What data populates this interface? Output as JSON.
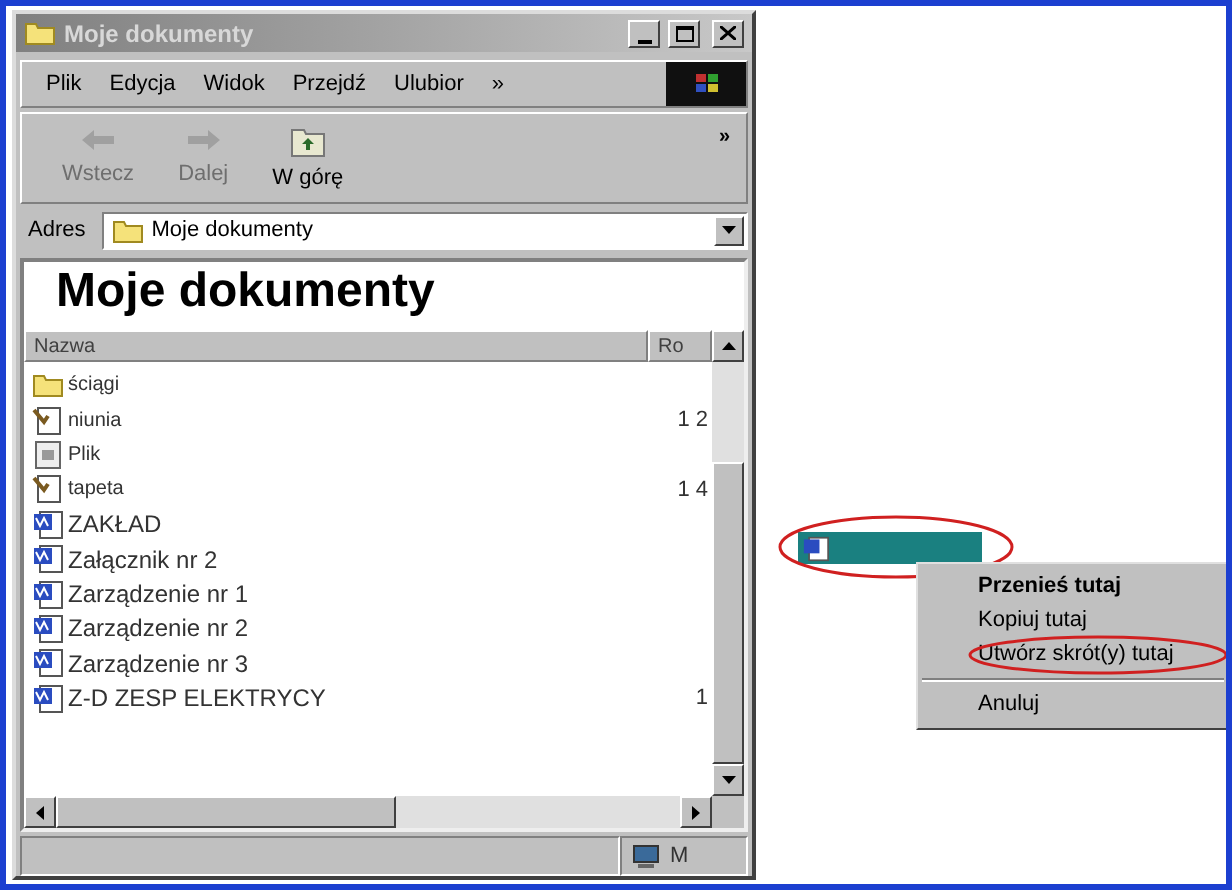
{
  "window": {
    "title": "Moje dokumenty"
  },
  "menu": [
    "Plik",
    "Edycja",
    "Widok",
    "Przejdź",
    "Ulubior",
    "»"
  ],
  "toolbar": [
    {
      "label": "Wstecz",
      "kind": "back",
      "disabled": true
    },
    {
      "label": "Dalej",
      "kind": "forward",
      "disabled": true
    },
    {
      "label": "W górę",
      "kind": "up",
      "disabled": false
    }
  ],
  "toolbar_more": "»",
  "address": {
    "label": "Adres",
    "value": "Moje dokumenty"
  },
  "heading": "Moje dokumenty",
  "columns": [
    "Nazwa",
    "Ro"
  ],
  "files": [
    {
      "name": "ściągi",
      "kind": "folder"
    },
    {
      "name": "niunia",
      "kind": "image",
      "size": "1 2"
    },
    {
      "name": "Plik",
      "kind": "file"
    },
    {
      "name": "tapeta",
      "kind": "image",
      "size": "1 4"
    },
    {
      "name": "ZAKŁAD",
      "kind": "doc"
    },
    {
      "name": "Załącznik nr 2",
      "kind": "doc"
    },
    {
      "name": "Zarządzenie  nr 1",
      "kind": "doc"
    },
    {
      "name": "Zarządzenie  nr 2",
      "kind": "doc"
    },
    {
      "name": "Zarządzenie  nr 3",
      "kind": "doc"
    },
    {
      "name": "Z-D ZESP ELEKTRYCY",
      "kind": "doc",
      "size": "1"
    }
  ],
  "status_bar": {
    "zone": "M"
  },
  "context_menu": [
    {
      "label": "Przenieś tutaj",
      "default": true,
      "circled": false
    },
    {
      "label": "Kopiuj tutaj",
      "default": false,
      "circled": false
    },
    {
      "label": "Utwórz skrót(y) tutaj",
      "default": false,
      "circled": true
    },
    {
      "label": "Anuluj",
      "default": false,
      "circled": false,
      "separator_before": true
    }
  ]
}
